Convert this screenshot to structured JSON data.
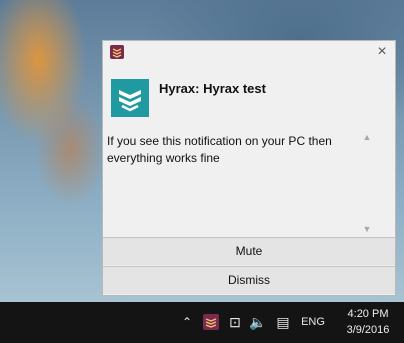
{
  "notification": {
    "title": "Hyrax: Hyrax test",
    "body": "If you see this notification on your PC then everything works fine",
    "close_icon": "×",
    "app_icon": "hyrax-logo-icon",
    "scroll_up_icon": "▲",
    "scroll_down_icon": "▼",
    "buttons": {
      "mute": "Mute",
      "dismiss": "Dismiss"
    },
    "accent_color": "#1f9aa0",
    "small_icon_color": "#7a2a4f"
  },
  "taskbar": {
    "tray_up_icon": "⌃",
    "network_icon": "⊡",
    "volume_icon": "🔈",
    "chat_icon": "▤",
    "language": "ENG",
    "time": "4:20 PM",
    "date": "3/9/2016"
  }
}
